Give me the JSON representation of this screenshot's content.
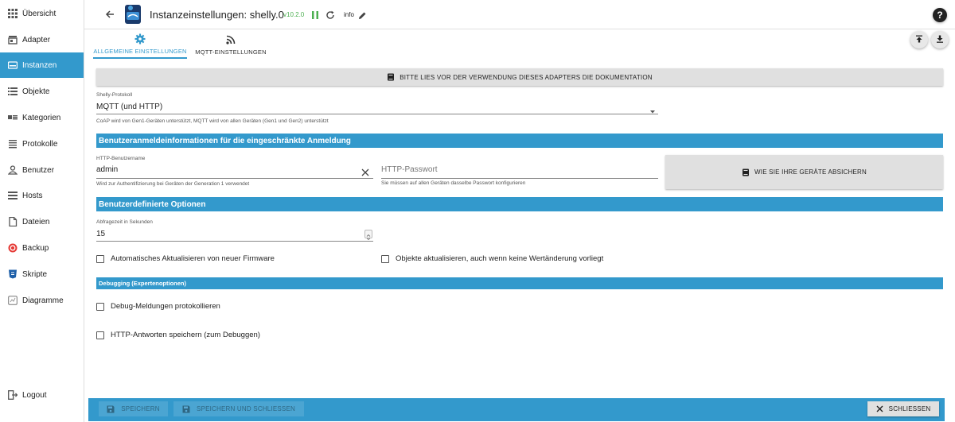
{
  "sidebar": {
    "items": [
      {
        "label": "Übersicht",
        "icon": "grid-icon"
      },
      {
        "label": "Adapter",
        "icon": "store-icon"
      },
      {
        "label": "Instanzen",
        "icon": "instances-icon",
        "active": true
      },
      {
        "label": "Objekte",
        "icon": "list-icon"
      },
      {
        "label": "Kategorien",
        "icon": "categories-icon"
      },
      {
        "label": "Protokolle",
        "icon": "log-icon"
      },
      {
        "label": "Benutzer",
        "icon": "user-icon"
      },
      {
        "label": "Hosts",
        "icon": "hosts-icon"
      },
      {
        "label": "Dateien",
        "icon": "file-icon"
      },
      {
        "label": "Backup",
        "icon": "backup-icon"
      },
      {
        "label": "Skripte",
        "icon": "scripts-icon"
      },
      {
        "label": "Diagramme",
        "icon": "diagram-icon"
      }
    ],
    "logout_label": "Logout"
  },
  "header": {
    "title": "Instanzeinstellungen:  shelly.0",
    "version": "v10.2.0",
    "loglevel": "info"
  },
  "tabs": [
    {
      "label": "ALLGEMEINE EINSTELLUNGEN",
      "active": true
    },
    {
      "label": "MQTT-EINSTELLUNGEN",
      "active": false
    }
  ],
  "doc_button": "BITTE LIES VOR DER VERWENDUNG DIESES ADAPTERS DIE DOKUMENTATION",
  "protocol": {
    "label": "Shelly-Protokoll",
    "value": "MQTT (und HTTP)",
    "help": "CoAP wird von Gen1-Geräten unterstützt, MQTT wird von allen Geräten (Gen1 und Gen2) unterstützt"
  },
  "section_auth": "Benutzeranmeldeinformationen für die eingeschränkte Anmeldung",
  "http_user": {
    "label": "HTTP-Benutzername",
    "value": "admin",
    "help": "Wird zur Authentifizierung bei Geräten der Generation 1 verwendet"
  },
  "http_password": {
    "placeholder": "HTTP-Passwort",
    "help": "Sie müssen auf allen Geräten dasselbe Passwort konfigurieren"
  },
  "secure_button": "WIE SIE IHRE GERÄTE ABSICHERN",
  "section_custom": "Benutzerdefinierte Optionen",
  "poll_interval": {
    "label": "Abfragezeit in Sekunden",
    "value": "15"
  },
  "checkboxes": {
    "auto_update": "Automatisches Aktualisieren von neuer Firmware",
    "update_objects": "Objekte aktualisieren, auch wenn keine Wertänderung vorliegt",
    "debug_log": "Debug-Meldungen protokollieren",
    "save_http": "HTTP-Antworten speichern (zum Debuggen)"
  },
  "section_debug": "Debugging (Expertenoptionen)",
  "footer": {
    "save_label": "SPEICHERN",
    "save_close_label": "SPEICHERN UND SCHLIESSEN",
    "close_label": "SCHLIESSEN"
  },
  "colors": {
    "accent": "#3399cc",
    "version": "#4caf50"
  }
}
